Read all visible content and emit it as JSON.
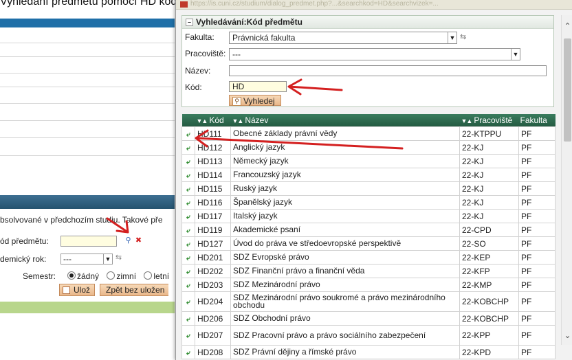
{
  "background": {
    "heading": "Vyhledání předmětu pomocí HD kódu",
    "note": "bsolvované v předchozím studiu. Takové pře",
    "course_code_label": "ód předmětu:",
    "year_label": "demický rok:",
    "year_value": "---",
    "semester_label": "Semestr:",
    "semester_options": [
      "žádný",
      "zimní",
      "letní"
    ],
    "save_button": "Ulož",
    "back_button": "Zpět bez uložen",
    "search_icon": "magnifier-icon",
    "clear_icon": "x-icon"
  },
  "popup": {
    "url": "https://is.cuni.cz/studium/dialog_predmet.php?...&searchkod=HD&searchvizek=...",
    "title": "Vyhledávání:Kód předmětu",
    "form": {
      "faculty_label": "Fakulta:",
      "faculty_value": "Právnická fakulta",
      "department_label": "Pracoviště:",
      "department_value": "---",
      "name_label": "Název:",
      "name_value": "",
      "code_label": "Kód:",
      "code_value": "HD",
      "search_button": "Vyhledej"
    },
    "table": {
      "headers": {
        "code": "Kód",
        "name": "Název",
        "department": "Pracoviště",
        "faculty": "Fakulta"
      },
      "rows": [
        {
          "code": "HD111",
          "name": "Obecné základy právní vědy",
          "department": "22-KTPPU",
          "faculty": "PF"
        },
        {
          "code": "HD112",
          "name": "Anglický jazyk",
          "department": "22-KJ",
          "faculty": "PF"
        },
        {
          "code": "HD113",
          "name": "Německý jazyk",
          "department": "22-KJ",
          "faculty": "PF"
        },
        {
          "code": "HD114",
          "name": "Francouzský jazyk",
          "department": "22-KJ",
          "faculty": "PF"
        },
        {
          "code": "HD115",
          "name": "Ruský jazyk",
          "department": "22-KJ",
          "faculty": "PF"
        },
        {
          "code": "HD116",
          "name": "Španělský jazyk",
          "department": "22-KJ",
          "faculty": "PF"
        },
        {
          "code": "HD117",
          "name": "Italský jazyk",
          "department": "22-KJ",
          "faculty": "PF"
        },
        {
          "code": "HD119",
          "name": "Akademické psaní",
          "department": "22-CPD",
          "faculty": "PF"
        },
        {
          "code": "HD127",
          "name": "Úvod do práva ve středoevropské perspektivě",
          "department": "22-SO",
          "faculty": "PF"
        },
        {
          "code": "HD201",
          "name": "SDZ Evropské právo",
          "department": "22-KEP",
          "faculty": "PF"
        },
        {
          "code": "HD202",
          "name": "SDZ Finanční právo a finanční věda",
          "department": "22-KFP",
          "faculty": "PF"
        },
        {
          "code": "HD203",
          "name": "SDZ Mezinárodní právo",
          "department": "22-KMP",
          "faculty": "PF"
        },
        {
          "code": "HD204",
          "name": "SDZ Mezinárodní právo soukromé a právo mezinárodního obchodu",
          "department": "22-KOBCHP",
          "faculty": "PF"
        },
        {
          "code": "HD206",
          "name": "SDZ Obchodní právo",
          "department": "22-KOBCHP",
          "faculty": "PF"
        },
        {
          "code": "HD207",
          "name": "SDZ Pracovní právo a právo sociálního zabezpečení",
          "department": "22-KPP",
          "faculty": "PF"
        },
        {
          "code": "HD208",
          "name": "SDZ Právní dějiny a římské právo",
          "department": "22-KPD",
          "faculty": "PF"
        }
      ]
    }
  },
  "colors": {
    "arrow": "#d42020",
    "table_header": "#2f6d50",
    "button": "#edc29a",
    "page_bar": "#1f6fa8"
  }
}
